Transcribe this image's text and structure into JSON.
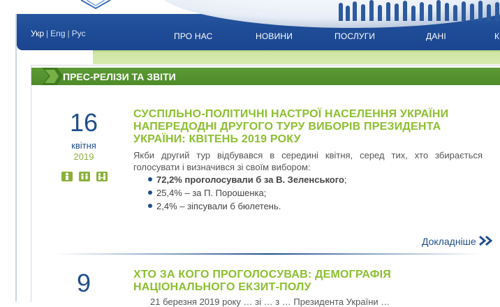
{
  "header": {
    "languages": [
      {
        "label": "Укр",
        "active": true
      },
      {
        "label": "Eng",
        "active": false
      },
      {
        "label": "Рус",
        "active": false
      }
    ],
    "nav": [
      "ПРО НАС",
      "НОВИНИ",
      "ПОСЛУГИ",
      "ДАНІ",
      "К"
    ]
  },
  "section": {
    "title": "ПРЕС-РЕЛІЗИ ТА ЗВІТИ"
  },
  "articles": [
    {
      "day": "16",
      "month": "квітня",
      "year": "2019",
      "icons": [
        "person-icon",
        "group-icon",
        "people-icon"
      ],
      "title_lines": [
        "СУСПІЛЬНО-ПОЛІТИЧНІ НАСТРОЇ НАСЕЛЕННЯ УКРАЇНИ",
        "НАПЕРЕДОДНІ ДРУГОГО ТУРУ ВИБОРІВ ПРЕЗИДЕНТА",
        "УКРАЇНИ: КВІТЕНЬ 2019 РОКУ"
      ],
      "intro": "Якби другий тур відбувався в середині квітня, серед тих, хто збирається голосувати і визначився зі своїм вибором:",
      "bullets": [
        {
          "bold": "72,2% проголосували б за В. Зеленського",
          "rest": ";"
        },
        {
          "bold": "",
          "rest": "25,4% – за П. Порошенка;"
        },
        {
          "bold": "",
          "rest": "2,4% – зіпсували б бюлетень."
        }
      ],
      "more_label": "Докладніше"
    },
    {
      "day": "9",
      "title_lines": [
        "ХТО ЗА КОГО ПРОГОЛОСУВАВ: ДЕМОГРАФІЯ",
        "НАЦІОНАЛЬНОГО ЕКЗИТ-ПОЛУ"
      ],
      "partial_text": "21 березня 2019 року … зі … з … Президента України … "
    }
  ],
  "colors": {
    "header_blue": "#1f4d97",
    "green_bar": "#5d9b35",
    "headline_green": "#8cbf2f",
    "date_blue": "#1f4e8c"
  }
}
